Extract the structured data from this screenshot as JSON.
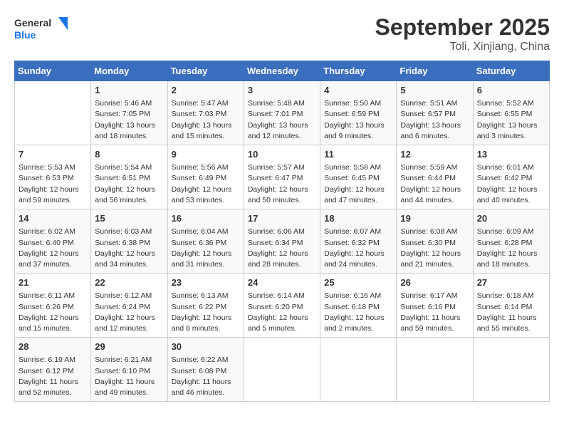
{
  "logo": {
    "line1": "General",
    "line2": "Blue"
  },
  "title": "September 2025",
  "location": "Toli, Xinjiang, China",
  "weekdays": [
    "Sunday",
    "Monday",
    "Tuesday",
    "Wednesday",
    "Thursday",
    "Friday",
    "Saturday"
  ],
  "weeks": [
    [
      {
        "day": null
      },
      {
        "day": "1",
        "sunrise": "5:46 AM",
        "sunset": "7:05 PM",
        "daylight": "13 hours and 18 minutes."
      },
      {
        "day": "2",
        "sunrise": "5:47 AM",
        "sunset": "7:03 PM",
        "daylight": "13 hours and 15 minutes."
      },
      {
        "day": "3",
        "sunrise": "5:48 AM",
        "sunset": "7:01 PM",
        "daylight": "13 hours and 12 minutes."
      },
      {
        "day": "4",
        "sunrise": "5:50 AM",
        "sunset": "6:59 PM",
        "daylight": "13 hours and 9 minutes."
      },
      {
        "day": "5",
        "sunrise": "5:51 AM",
        "sunset": "6:57 PM",
        "daylight": "13 hours and 6 minutes."
      },
      {
        "day": "6",
        "sunrise": "5:52 AM",
        "sunset": "6:55 PM",
        "daylight": "13 hours and 3 minutes."
      }
    ],
    [
      {
        "day": "7",
        "sunrise": "5:53 AM",
        "sunset": "6:53 PM",
        "daylight": "12 hours and 59 minutes."
      },
      {
        "day": "8",
        "sunrise": "5:54 AM",
        "sunset": "6:51 PM",
        "daylight": "12 hours and 56 minutes."
      },
      {
        "day": "9",
        "sunrise": "5:56 AM",
        "sunset": "6:49 PM",
        "daylight": "12 hours and 53 minutes."
      },
      {
        "day": "10",
        "sunrise": "5:57 AM",
        "sunset": "6:47 PM",
        "daylight": "12 hours and 50 minutes."
      },
      {
        "day": "11",
        "sunrise": "5:58 AM",
        "sunset": "6:45 PM",
        "daylight": "12 hours and 47 minutes."
      },
      {
        "day": "12",
        "sunrise": "5:59 AM",
        "sunset": "6:44 PM",
        "daylight": "12 hours and 44 minutes."
      },
      {
        "day": "13",
        "sunrise": "6:01 AM",
        "sunset": "6:42 PM",
        "daylight": "12 hours and 40 minutes."
      }
    ],
    [
      {
        "day": "14",
        "sunrise": "6:02 AM",
        "sunset": "6:40 PM",
        "daylight": "12 hours and 37 minutes."
      },
      {
        "day": "15",
        "sunrise": "6:03 AM",
        "sunset": "6:38 PM",
        "daylight": "12 hours and 34 minutes."
      },
      {
        "day": "16",
        "sunrise": "6:04 AM",
        "sunset": "6:36 PM",
        "daylight": "12 hours and 31 minutes."
      },
      {
        "day": "17",
        "sunrise": "6:06 AM",
        "sunset": "6:34 PM",
        "daylight": "12 hours and 28 minutes."
      },
      {
        "day": "18",
        "sunrise": "6:07 AM",
        "sunset": "6:32 PM",
        "daylight": "12 hours and 24 minutes."
      },
      {
        "day": "19",
        "sunrise": "6:08 AM",
        "sunset": "6:30 PM",
        "daylight": "12 hours and 21 minutes."
      },
      {
        "day": "20",
        "sunrise": "6:09 AM",
        "sunset": "6:28 PM",
        "daylight": "12 hours and 18 minutes."
      }
    ],
    [
      {
        "day": "21",
        "sunrise": "6:11 AM",
        "sunset": "6:26 PM",
        "daylight": "12 hours and 15 minutes."
      },
      {
        "day": "22",
        "sunrise": "6:12 AM",
        "sunset": "6:24 PM",
        "daylight": "12 hours and 12 minutes."
      },
      {
        "day": "23",
        "sunrise": "6:13 AM",
        "sunset": "6:22 PM",
        "daylight": "12 hours and 8 minutes."
      },
      {
        "day": "24",
        "sunrise": "6:14 AM",
        "sunset": "6:20 PM",
        "daylight": "12 hours and 5 minutes."
      },
      {
        "day": "25",
        "sunrise": "6:16 AM",
        "sunset": "6:18 PM",
        "daylight": "12 hours and 2 minutes."
      },
      {
        "day": "26",
        "sunrise": "6:17 AM",
        "sunset": "6:16 PM",
        "daylight": "11 hours and 59 minutes."
      },
      {
        "day": "27",
        "sunrise": "6:18 AM",
        "sunset": "6:14 PM",
        "daylight": "11 hours and 55 minutes."
      }
    ],
    [
      {
        "day": "28",
        "sunrise": "6:19 AM",
        "sunset": "6:12 PM",
        "daylight": "11 hours and 52 minutes."
      },
      {
        "day": "29",
        "sunrise": "6:21 AM",
        "sunset": "6:10 PM",
        "daylight": "11 hours and 49 minutes."
      },
      {
        "day": "30",
        "sunrise": "6:22 AM",
        "sunset": "6:08 PM",
        "daylight": "11 hours and 46 minutes."
      },
      {
        "day": null
      },
      {
        "day": null
      },
      {
        "day": null
      },
      {
        "day": null
      }
    ]
  ]
}
